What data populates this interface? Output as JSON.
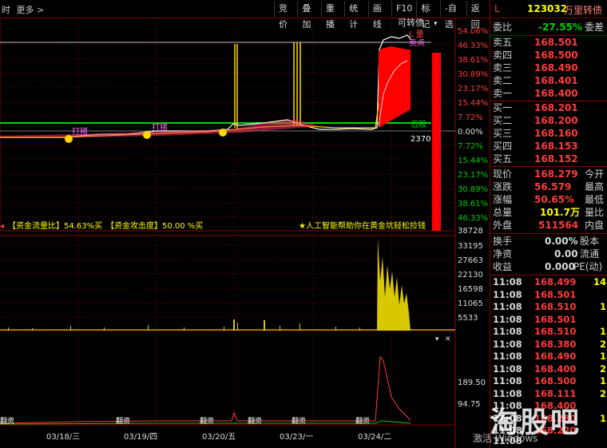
{
  "toolbar": {
    "left_items": [
      "时",
      "更多 >"
    ],
    "buttons": [
      "竞价",
      "叠加",
      "重播",
      "统计",
      "画线",
      "F10",
      "标记",
      "-自选",
      "返回"
    ]
  },
  "chart": {
    "series_label": "可转债",
    "right_axis_top": [
      "54.06%",
      "46.33%",
      "38.61%",
      "30.89%",
      "23.17%",
      "15.44%",
      "7.72%",
      "0.00%",
      "7.72%",
      "15.44%",
      "23.17%",
      "30.89%",
      "38.61%",
      "46.33%"
    ],
    "annotations": {
      "sell_label": "卖点",
      "low_label": "低吸",
      "low_value": "2370",
      "buy_marks": [
        "打猪",
        "打猪"
      ],
      "top_marker": "L 量"
    },
    "indicator_text": {
      "flow": "【资金流量比】54.63%买",
      "attack": "【资金攻击度】50.00 %买",
      "ad": "★人工智能帮助你在黄金坑轻松捡钱"
    },
    "volume_axis": [
      "38728",
      "33195",
      "27663",
      "22130",
      "16598",
      "11065",
      "5533"
    ],
    "lower_axis": [
      "189.50",
      "94.75"
    ],
    "lower_labels": [
      "翻资",
      "翻资",
      "翻资",
      "翻资",
      "翻资",
      "翻资"
    ],
    "dates": [
      "03/18/三",
      "03/19/四",
      "03/20/五",
      "03/23/一",
      "03/24/二"
    ]
  },
  "panel": {
    "tag": "L",
    "code": "123032",
    "name": "万里转债",
    "weibi_label": "委比",
    "weibi_value": "-27.55%",
    "weicha_label": "委差",
    "asks": [
      {
        "label": "卖五",
        "price": "168.501"
      },
      {
        "label": "卖四",
        "price": "168.500"
      },
      {
        "label": "卖三",
        "price": "168.490"
      },
      {
        "label": "卖二",
        "price": "168.401"
      },
      {
        "label": "卖一",
        "price": "168.400"
      }
    ],
    "bids": [
      {
        "label": "买一",
        "price": "168.201"
      },
      {
        "label": "买二",
        "price": "168.200"
      },
      {
        "label": "买三",
        "price": "168.160"
      },
      {
        "label": "买四",
        "price": "168.153"
      },
      {
        "label": "买五",
        "price": "168.152"
      }
    ],
    "stats": [
      {
        "label": "现价",
        "value": "168.279",
        "label2": "今开"
      },
      {
        "label": "涨跌",
        "value": "56.579",
        "label2": "最高"
      },
      {
        "label": "涨幅",
        "value": "50.65%",
        "label2": "最低"
      },
      {
        "label": "总量",
        "value": "101.7万",
        "label2": "量比"
      },
      {
        "label": "外盘",
        "value": "511564",
        "label2": "内盘"
      }
    ],
    "extra": [
      {
        "label": "换手",
        "value": "0.00%",
        "label2": "股本"
      },
      {
        "label": "净资",
        "value": "0.00",
        "label2": "流通"
      },
      {
        "label": "收益",
        "value": "0.000",
        "label2": "PE(动)"
      }
    ],
    "ticks": [
      {
        "t": "11:08",
        "p": "168.499",
        "v": "14"
      },
      {
        "t": "11:08",
        "p": "168.501",
        "v": ""
      },
      {
        "t": "11:08",
        "p": "168.510",
        "v": "1"
      },
      {
        "t": "11:08",
        "p": "168.501",
        "v": ""
      },
      {
        "t": "11:08",
        "p": "168.510",
        "v": "1"
      },
      {
        "t": "11:08",
        "p": "168.380",
        "v": "2"
      },
      {
        "t": "11:08",
        "p": "168.490",
        "v": "1"
      },
      {
        "t": "11:08",
        "p": "168.400",
        "v": "2"
      },
      {
        "t": "11:08",
        "p": "168.500",
        "v": "1"
      },
      {
        "t": "11:08",
        "p": "168.111",
        "v": "2"
      },
      {
        "t": "11:08",
        "p": "168.400",
        "v": ""
      },
      {
        "t": "11:08",
        "p": "168.280",
        "v": "1"
      },
      {
        "t": "11:08",
        "p": "168.220",
        "v": ""
      },
      {
        "t": "11:08",
        "p": "",
        "v": ""
      }
    ],
    "watermark": "淘股吧",
    "watermark_sub": "激活 Windows"
  }
}
